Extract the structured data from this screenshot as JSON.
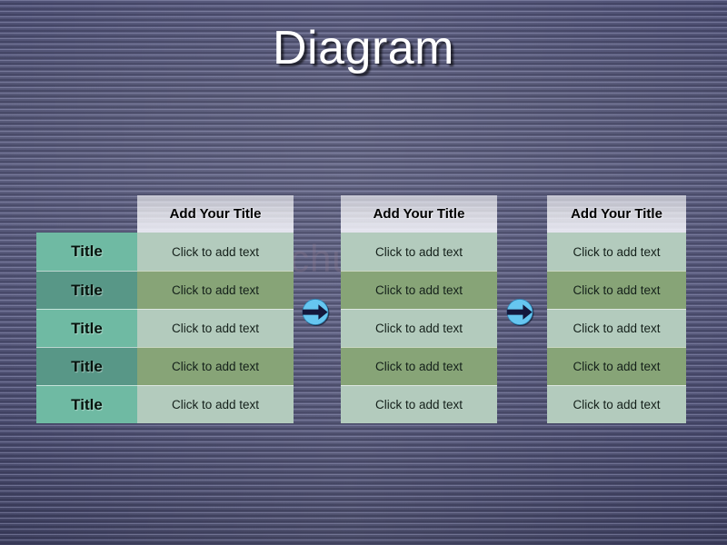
{
  "slide": {
    "title": "Diagram",
    "watermark": "jinchutou.com",
    "background": {
      "base_color": "#56587a",
      "stripe_light": "#a8aacd",
      "stripe_dark": "#14142c"
    }
  },
  "theme": {
    "header_fill": "#eef0f6",
    "body_light_green": "#b3cbbd",
    "body_dark_green": "#87a477",
    "title_light_teal": "#6fbaa3",
    "title_dark_teal": "#589787",
    "arrow_circle": "#66c6f0",
    "arrow_glyph": "#14183c",
    "title_text_color": "#ffffff"
  },
  "diagram": {
    "type": "three-stage-table-with-arrows",
    "title_column": {
      "labels": [
        "Title",
        "Title",
        "Title",
        "Title",
        "Title"
      ],
      "shades": [
        "light",
        "dark",
        "light",
        "dark",
        "light"
      ]
    },
    "stacks": [
      {
        "header": "Add Your Title",
        "cells": [
          "Click to add text",
          "Click to add text",
          "Click to add text",
          "Click to add text",
          "Click to add text"
        ],
        "shades": [
          "light",
          "dark",
          "light",
          "dark",
          "light"
        ]
      },
      {
        "header": "Add Your Title",
        "cells": [
          "Click to add text",
          "Click to add text",
          "Click to add text",
          "Click to add text",
          "Click to add text"
        ],
        "shades": [
          "light",
          "dark",
          "light",
          "dark",
          "light"
        ]
      },
      {
        "header": "Add Your Title",
        "cells": [
          "Click to add text",
          "Click to add text",
          "Click to add text",
          "Click to add text",
          "Click to add text"
        ],
        "shades": [
          "light",
          "dark",
          "light",
          "dark",
          "light"
        ]
      }
    ],
    "connectors": [
      {
        "icon": "arrow-right-circle-icon"
      },
      {
        "icon": "arrow-right-circle-icon"
      }
    ]
  }
}
